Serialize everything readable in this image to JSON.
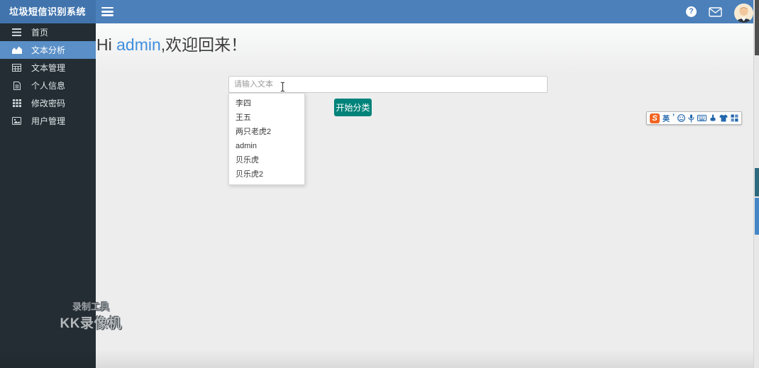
{
  "app": {
    "title": "垃圾短信识别系统"
  },
  "navbar": {
    "icons": [
      "hamburger-icon",
      "help-icon",
      "mail-icon",
      "user-avatar"
    ]
  },
  "sidebar": {
    "items": [
      {
        "label": "首页",
        "icon": "bars-icon",
        "active": false
      },
      {
        "label": "文本分析",
        "icon": "area-chart-icon",
        "active": true
      },
      {
        "label": "文本管理",
        "icon": "table-icon",
        "active": false
      },
      {
        "label": "个人信息",
        "icon": "file-text-icon",
        "active": false
      },
      {
        "label": "修改密码",
        "icon": "th-grid-icon",
        "active": false
      },
      {
        "label": "用户管理",
        "icon": "image-icon",
        "active": false
      }
    ]
  },
  "main": {
    "greeting": {
      "prefix": "Hi ",
      "username": "admin",
      "suffix": ",欢迎回来！"
    },
    "input": {
      "placeholder": "请输入文本",
      "value": ""
    },
    "classify_button": "开始分类",
    "dropdown": {
      "items": [
        "李四",
        "王五",
        "两只老虎2",
        "admin",
        "贝乐虎",
        "贝乐虎2"
      ]
    }
  },
  "ime_toolbar": {
    "name": "sogou-input-bar",
    "logo": "S",
    "mode": "英",
    "punct": "’",
    "icons": [
      "sogou-logo-icon",
      "emoji-icon",
      "mic-icon",
      "keyboard-icon",
      "handwriting-icon",
      "skin-icon",
      "toolbox-icon"
    ]
  },
  "watermark": {
    "line1": "录制工具",
    "line2": "KK录像机"
  },
  "colors": {
    "navbar": "#4b80ba",
    "logo_bg": "#4174ad",
    "sidebar_bg": "#232d33",
    "sidebar_active": "#5a8fc7",
    "button_teal": "#00837a",
    "link_blue": "#3f8ede",
    "content_bg": "#ededee",
    "sogou_orange": "#f26522",
    "ime_icon_blue": "#2267ad",
    "scroll_thumb": "#4f4f4f",
    "scroll_mark_teal": "#2d6a80",
    "scroll_mark_blue": "#4486c6"
  }
}
